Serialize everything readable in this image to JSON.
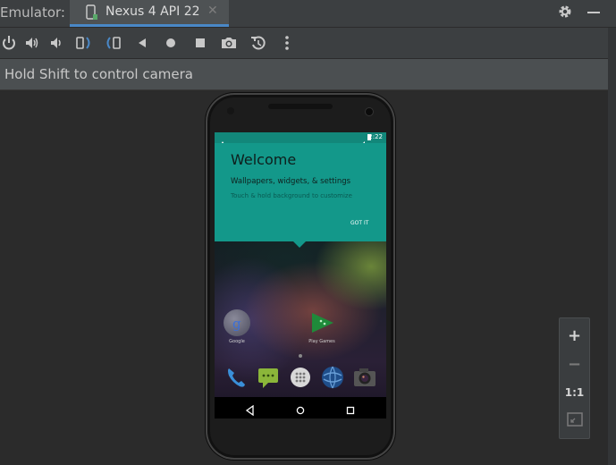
{
  "window": {
    "app_label": "Emulator:",
    "tab_title": "Nexus 4 API 22",
    "tab_close": "✕"
  },
  "toolbar": {
    "tools": [
      "power-icon",
      "volume-up-icon",
      "volume-down-icon",
      "rotate-left-icon",
      "rotate-right-icon",
      "back-icon",
      "home-icon",
      "overview-icon",
      "screenshot-icon",
      "snapshot-icon",
      "more-icon"
    ]
  },
  "info_bar": {
    "hint": "Hold Shift to control camera"
  },
  "device": {
    "status_time": "2:22",
    "welcome_title": "Welcome",
    "welcome_subtitle": "Wallpapers, widgets, & settings",
    "welcome_hint": "Touch & hold background to customize",
    "got_it": "GOT IT",
    "apps": [
      {
        "label": "Google",
        "icon": "google-folder-icon"
      },
      {
        "label": "Play Games",
        "icon": "play-games-icon"
      }
    ],
    "dock": [
      "phone-icon",
      "messaging-icon",
      "app-drawer-icon",
      "browser-icon",
      "camera-icon"
    ],
    "nav": [
      "nav-back-icon",
      "nav-home-icon",
      "nav-recents-icon"
    ]
  },
  "zoom": {
    "zoom_in": "+",
    "zoom_out": "−",
    "one_to_one": "1:1"
  },
  "colors": {
    "accent_blue": "#4a88c7",
    "teal_card": "#13988a",
    "status_teal": "#12877a"
  }
}
